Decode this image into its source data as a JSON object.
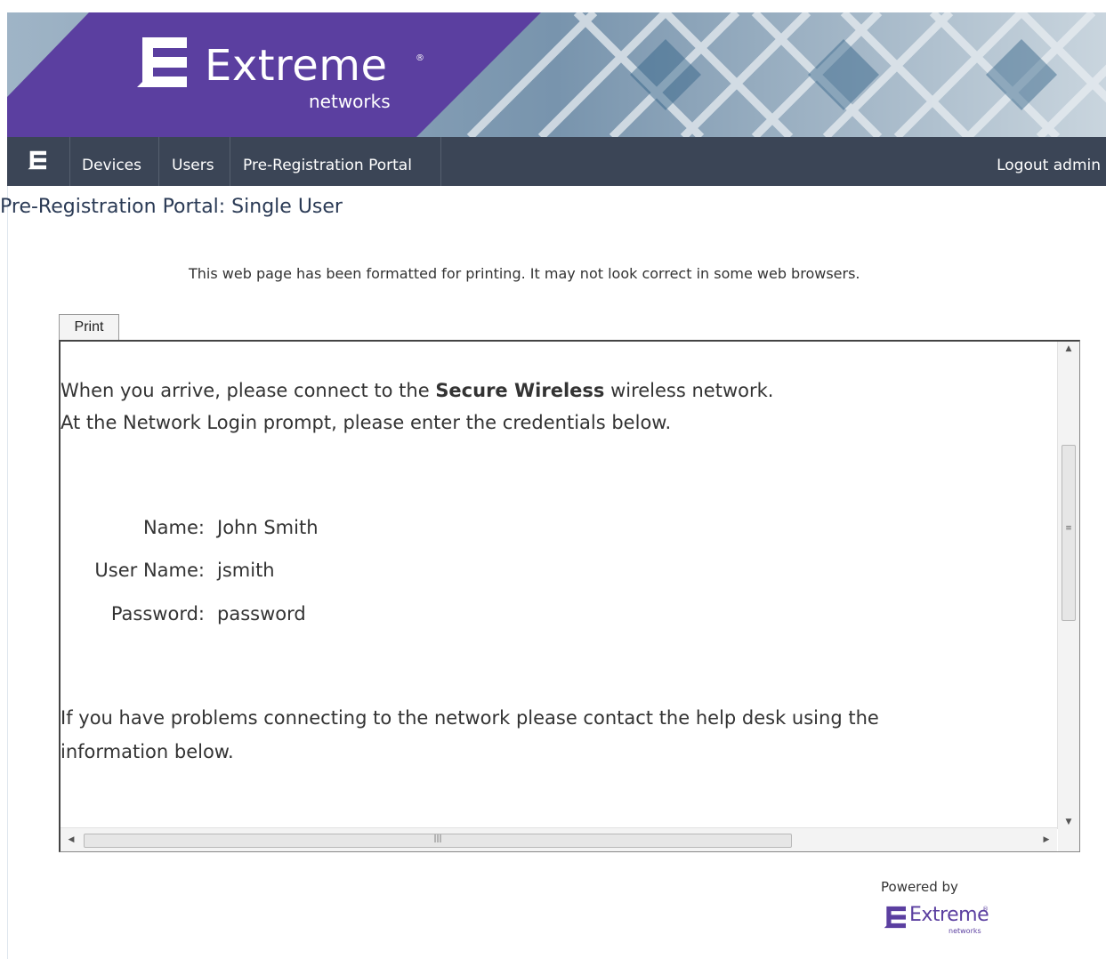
{
  "brand": {
    "name": "Extreme",
    "sub": "networks",
    "reg_mark": "®",
    "banner_purple": "#5b3fa0",
    "logo_icon": "extreme-networks-logo-icon"
  },
  "nav": {
    "items": [
      {
        "label": "Devices"
      },
      {
        "label": "Users"
      },
      {
        "label": "Pre-Registration Portal"
      }
    ],
    "logout_label": "Logout admin",
    "bar_color": "#3b4556"
  },
  "page": {
    "title": "Pre-Registration Portal: Single User",
    "print_note": "This web page has been formatted for printing. It may not look correct in some web browsers.",
    "print_button": "Print"
  },
  "printout": {
    "intro_before": "When you arrive, please connect to the ",
    "network_name": "Secure Wireless",
    "intro_after": " wireless network.",
    "intro_line2": "At the Network Login prompt, please enter the credentials below.",
    "credentials": [
      {
        "label": "Name:",
        "value": "John Smith"
      },
      {
        "label": "User Name:",
        "value": "jsmith"
      },
      {
        "label": "Password:",
        "value": "password"
      }
    ],
    "help_line1": "If you have problems connecting to the network please contact the help desk using the",
    "help_line2": "information below."
  },
  "footer": {
    "powered_by": "Powered by",
    "logo_name": "Extreme",
    "logo_sub": "networks",
    "reg_mark": "®"
  }
}
